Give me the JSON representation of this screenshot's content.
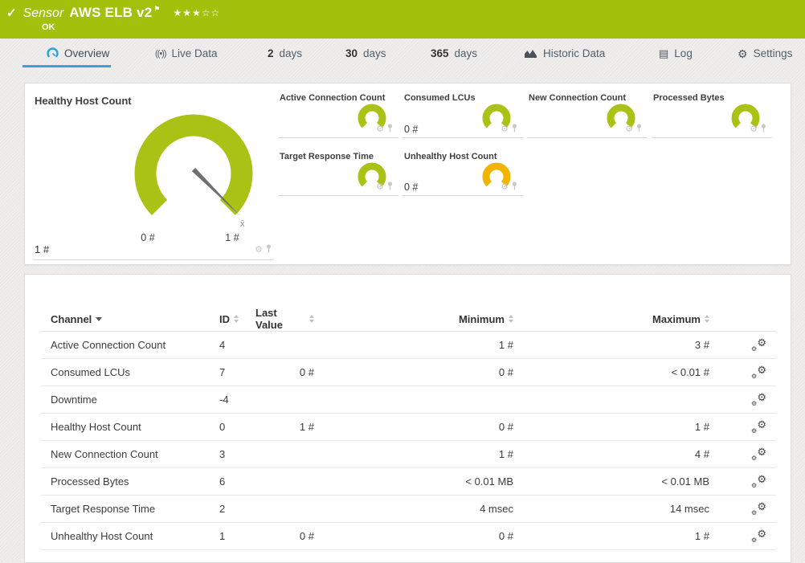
{
  "header": {
    "check_icon": "✓",
    "kind_label": "Sensor",
    "sensor_name": "AWS ELB v2",
    "flag_icon": "⚑",
    "stars_filled": "★★★",
    "stars_empty": "☆☆",
    "status": "OK"
  },
  "tabs": {
    "overview": {
      "label": "Overview"
    },
    "live_data": {
      "label": "Live Data",
      "icon_glyph": "((•))"
    },
    "days2": {
      "num": "2",
      "label": "days"
    },
    "days30": {
      "num": "30",
      "label": "days"
    },
    "days365": {
      "num": "365",
      "label": "days"
    },
    "historic": {
      "label": "Historic Data"
    },
    "log": {
      "label": "Log",
      "icon_glyph": "▤"
    },
    "settings": {
      "label": "Settings",
      "icon_glyph": "⚙"
    }
  },
  "gauges": {
    "main": {
      "title": "Healthy Host Count",
      "value": "1 #",
      "scale_min": "0 #",
      "scale_max": "1 #",
      "mean_marker": "x̄"
    },
    "small": [
      {
        "title": "Active Connection Count",
        "value": ""
      },
      {
        "title": "Consumed LCUs",
        "value": "0 #"
      },
      {
        "title": "New Connection Count",
        "value": ""
      },
      {
        "title": "Processed Bytes",
        "value": ""
      },
      {
        "title": "Target Response Time",
        "value": ""
      },
      {
        "title": "Unhealthy Host Count",
        "value": "0 #"
      }
    ],
    "gear_icon_glyph": "⚙"
  },
  "table": {
    "columns": {
      "channel": "Channel",
      "id": "ID",
      "last": "Last Value",
      "min": "Minimum",
      "max": "Maximum"
    },
    "rows": [
      {
        "channel": "Active Connection Count",
        "id": "4",
        "last": "",
        "min": "1 #",
        "max": "3 #"
      },
      {
        "channel": "Consumed LCUs",
        "id": "7",
        "last": "0 #",
        "min": "0 #",
        "max": "< 0.01 #"
      },
      {
        "channel": "Downtime",
        "id": "-4",
        "last": "",
        "min": "",
        "max": ""
      },
      {
        "channel": "Healthy Host Count",
        "id": "0",
        "last": "1 #",
        "min": "0 #",
        "max": "1 #"
      },
      {
        "channel": "New Connection Count",
        "id": "3",
        "last": "",
        "min": "1 #",
        "max": "4 #"
      },
      {
        "channel": "Processed Bytes",
        "id": "6",
        "last": "",
        "min": "< 0.01 MB",
        "max": "< 0.01 MB"
      },
      {
        "channel": "Target Response Time",
        "id": "2",
        "last": "",
        "min": "4 msec",
        "max": "14 msec"
      },
      {
        "channel": "Unhealthy Host Count",
        "id": "1",
        "last": "0 #",
        "min": "0 #",
        "max": "1 #"
      }
    ]
  },
  "colors": {
    "brand_green": "#a3c10c",
    "gauge_green": "#a9c215",
    "gauge_warning": "#f1b400",
    "tab_accent": "#3ba1dd"
  }
}
